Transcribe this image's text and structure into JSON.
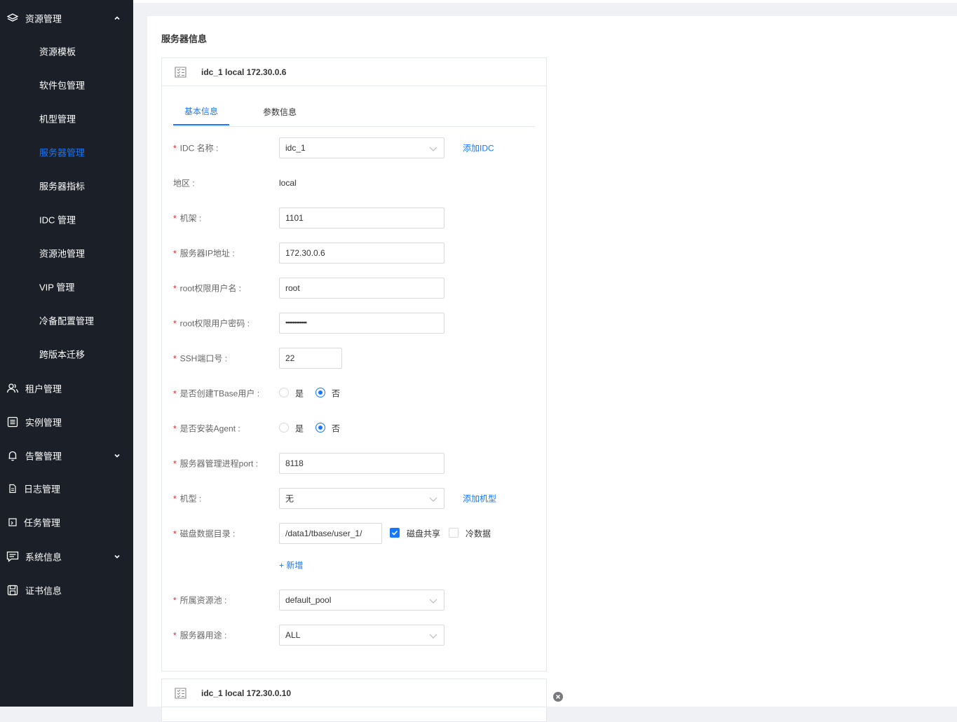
{
  "sidebar": {
    "resource_menu": {
      "label": "资源管理",
      "icon": "layers-icon"
    },
    "resource_items": [
      {
        "label": "资源模板",
        "active": false
      },
      {
        "label": "软件包管理",
        "active": false
      },
      {
        "label": "机型管理",
        "active": false
      },
      {
        "label": "服务器管理",
        "active": true
      },
      {
        "label": "服务器指标",
        "active": false
      },
      {
        "label": "IDC 管理",
        "active": false
      },
      {
        "label": "资源池管理",
        "active": false
      },
      {
        "label": "VIP 管理",
        "active": false
      },
      {
        "label": "冷备配置管理",
        "active": false
      },
      {
        "label": "跨版本迁移",
        "active": false
      }
    ],
    "tenant": {
      "label": "租户管理",
      "icon": "users-icon"
    },
    "instance": {
      "label": "实例管理",
      "icon": "list-icon"
    },
    "alarm": {
      "label": "告警管理",
      "icon": "bell-icon"
    },
    "log": {
      "label": "日志管理",
      "icon": "file-icon"
    },
    "task": {
      "label": "任务管理",
      "icon": "task-icon"
    },
    "system": {
      "label": "系统信息",
      "icon": "message-icon"
    },
    "cert": {
      "label": "证书信息",
      "icon": "save-icon"
    }
  },
  "main": {
    "section_title": "服务器信息",
    "card1": {
      "title": "idc_1 local 172.30.0.6",
      "tabs": {
        "basic": "基本信息",
        "params": "参数信息"
      },
      "idc": {
        "label": "IDC 名称 :",
        "value": "idc_1",
        "add_link": "添加IDC"
      },
      "region": {
        "label": "地区 :",
        "value": "local"
      },
      "rack": {
        "label": "机架 :",
        "value": "1101"
      },
      "ip": {
        "label": "服务器IP地址 :",
        "value": "172.30.0.6"
      },
      "root_user": {
        "label": "root权限用户名 :",
        "value": "root"
      },
      "root_pwd": {
        "label": "root权限用户密码 :",
        "value": "••••••••••••"
      },
      "ssh_port": {
        "label": "SSH端口号 :",
        "value": "22"
      },
      "create_user": {
        "label": "是否创建TBase用户 :",
        "yes": "是",
        "no": "否",
        "selected": "no"
      },
      "install_agent": {
        "label": "是否安装Agent :",
        "yes": "是",
        "no": "否",
        "selected": "no"
      },
      "mgr_port": {
        "label": "服务器管理进程port :",
        "value": "8118"
      },
      "model": {
        "label": "机型 :",
        "value": "无",
        "add_link": "添加机型"
      },
      "disk": {
        "label": "磁盘数据目录 :",
        "value": "/data1/tbase/user_1/",
        "shared_label": "磁盘共享",
        "shared_checked": true,
        "cold_label": "冷数据",
        "cold_checked": false
      },
      "add_new": "+ 新增",
      "pool": {
        "label": "所属资源池 :",
        "value": "default_pool"
      },
      "usage": {
        "label": "服务器用途 :",
        "value": "ALL"
      }
    },
    "card2": {
      "title": "idc_1 local 172.30.0.10"
    }
  }
}
